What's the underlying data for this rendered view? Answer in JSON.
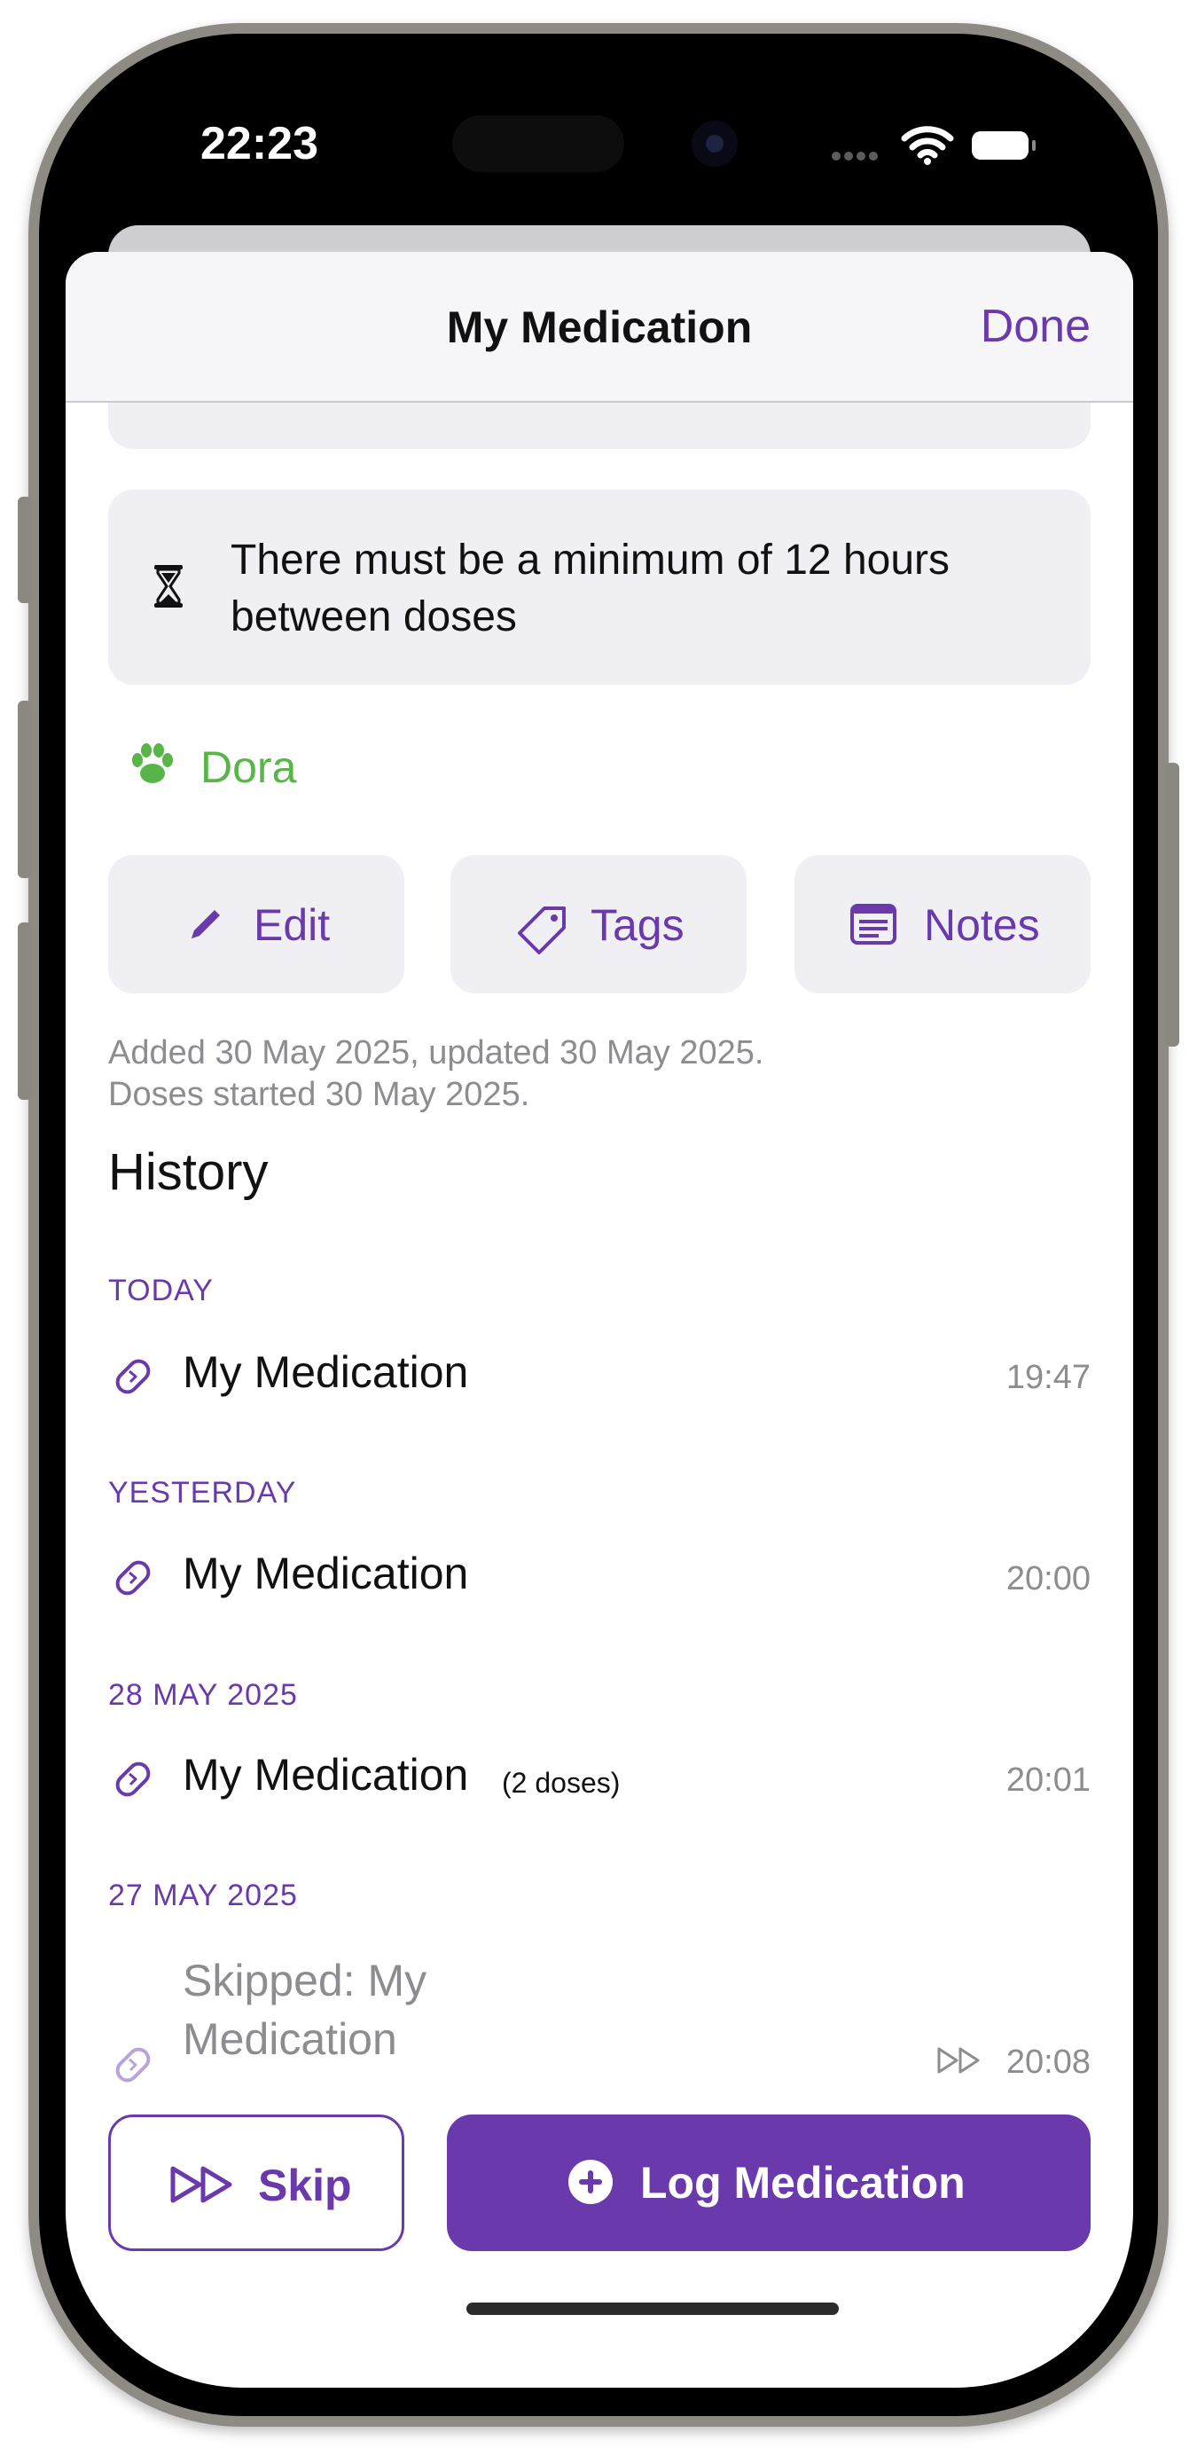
{
  "status_bar": {
    "time": "22:23"
  },
  "nav": {
    "title": "My Medication",
    "done_label": "Done"
  },
  "info_card": {
    "text": "There must be a minimum of 12 hours between doses"
  },
  "pet": {
    "name": "Dora"
  },
  "actions": {
    "edit_label": "Edit",
    "tags_label": "Tags",
    "notes_label": "Notes"
  },
  "meta": {
    "line1": "Added 30 May 2025, updated 30 May 2025.",
    "line2": "Doses started 30 May 2025."
  },
  "history": {
    "title": "History",
    "sections": [
      {
        "header": "TODAY",
        "entry": {
          "name": "My Medication",
          "extra": "",
          "time": "19:47"
        }
      },
      {
        "header": "YESTERDAY",
        "entry": {
          "name": "My Medication",
          "extra": "",
          "time": "20:00"
        }
      },
      {
        "header": "28 MAY 2025",
        "entry": {
          "name": "My Medication",
          "extra": "(2 doses)",
          "time": "20:01"
        }
      },
      {
        "header": "27 MAY 2025",
        "entry": {
          "name_line1": "Skipped: My",
          "name_line2": "Medication",
          "time": "20:08"
        }
      }
    ]
  },
  "bottom": {
    "skip_label": "Skip",
    "log_label": "Log Medication"
  },
  "colors": {
    "accent": "#6a3aad",
    "pet": "#58b548",
    "card": "#efeff4",
    "secondary_text": "#8c8c91"
  },
  "icons": [
    "hourglass-icon",
    "paw-icon",
    "pencil-icon",
    "tag-icon",
    "notes-icon",
    "pill-icon",
    "skip-forward-icon",
    "plus-circle-icon"
  ]
}
